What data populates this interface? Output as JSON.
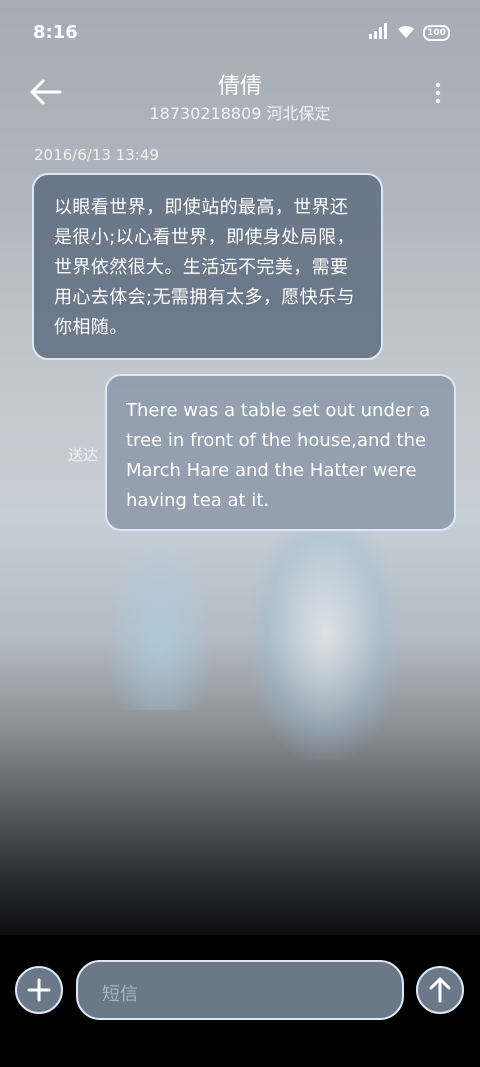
{
  "status_bar": {
    "time": "8:16",
    "battery_level": "100"
  },
  "header": {
    "contact_name": "倩倩",
    "contact_detail": "18730218809 河北保定"
  },
  "conversation": {
    "timestamp": "2016/6/13 13:49",
    "messages": [
      {
        "direction": "incoming",
        "text": "以眼看世界，即使站的最高，世界还是很小;以心看世界，即使身处局限，世界依然很大。生活远不完美，需要用心去体会;无需拥有太多，愿快乐与你相随。"
      },
      {
        "direction": "outgoing",
        "text": "There was a table set out under a tree in front of the house,and the March Hare and the Hatter were having tea at it.",
        "status": "送达"
      }
    ]
  },
  "input_bar": {
    "placeholder": "短信"
  },
  "colors": {
    "bubble_border": "#dfe7f5",
    "incoming_bubble": "#606e80",
    "outgoing_bubble": "#8c99aa",
    "control_fill": "#6a7888"
  }
}
